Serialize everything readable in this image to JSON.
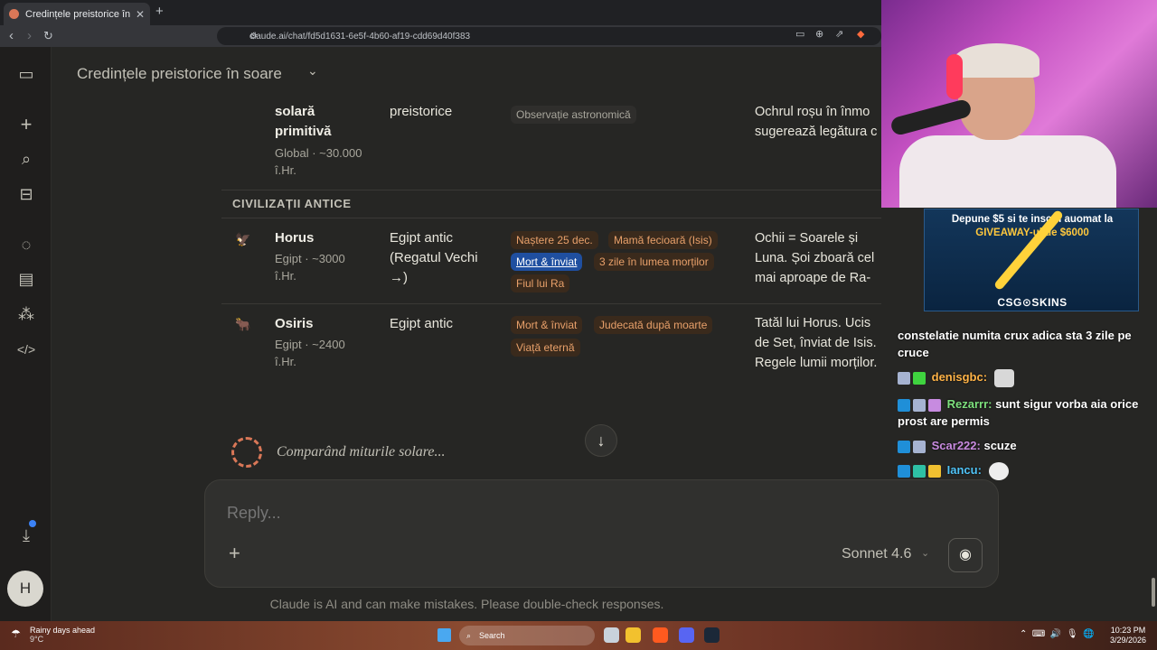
{
  "browser": {
    "tab_title": "Credințele preistorice în soare ·",
    "tab_close": "✕",
    "new_tab": "+",
    "url": "claude.ai/chat/fd5d1631-6e5f-4b60-af19-cdd69d40f383"
  },
  "chat": {
    "title": "Credințele preistorice în soare",
    "section_heading": "CIVILIZAȚII ANTICE",
    "rows": [
      {
        "name": "solară primitivă",
        "meta": "Global · ~30.000 î.Hr.",
        "period": "preistorice",
        "tags": [
          "Observație astronomică"
        ],
        "desc": "Ochrul roșu în înmo sugerează legătura c"
      },
      {
        "name": "Horus",
        "meta": "Egipt · ~3000 î.Hr.",
        "period": "Egipt antic (Regatul Vechi →)",
        "tags": [
          "Naștere 25 dec.",
          "Mamă fecioară (Isis)",
          "Mort & înviat",
          "3 zile în lumea morților",
          "Fiul lui Ra"
        ],
        "desc": "Ochii = Soarele și Luna. Șoi zboară cel mai aproape de Ra-Horakhty = fuziunea cu"
      },
      {
        "name": "Osiris",
        "meta": "Egipt · ~2400 î.Hr.",
        "period": "Egipt antic",
        "tags": [
          "Mort & înviat",
          "Judecată după moarte",
          "Viață eternă"
        ],
        "desc": "Tatăl lui Horus. Ucis de Set, înviat de Isis. Regele lumii morților. Primul zeu „al învierii”."
      }
    ],
    "loading_text": "Comparând miturile solare...",
    "reply_placeholder": "Reply...",
    "model": "Sonnet 4.6",
    "disclaimer": "Claude is AI and can make mistakes. Please double-check responses."
  },
  "sidebar": {
    "avatar_initial": "H"
  },
  "stream": {
    "ad_line1": "Depune $5 si te inscrii auomat la",
    "ad_line2": "GIVEAWAY-ul de $6000",
    "ad_logo": "CSG⊙SKINS",
    "chat_top": "constelatie numita crux adica sta 3 zile pe cruce",
    "messages": [
      {
        "user": "denisgbc:",
        "text": "",
        "user_color": "#ffb347"
      },
      {
        "user": "Rezarrr:",
        "text": "sunt sigur vorba aia orice prost are permis",
        "user_color": "#7de07d"
      },
      {
        "user": "Scar222:",
        "text": "scuze",
        "user_color": "#c98be0"
      },
      {
        "user": "Iancu:",
        "text": "",
        "user_color": "#4fc3f7"
      }
    ]
  },
  "taskbar": {
    "weather_title": "Rainy days ahead",
    "weather_temp": "9°C",
    "search": "Search",
    "time": "10:23 PM",
    "date": "3/29/2026"
  }
}
